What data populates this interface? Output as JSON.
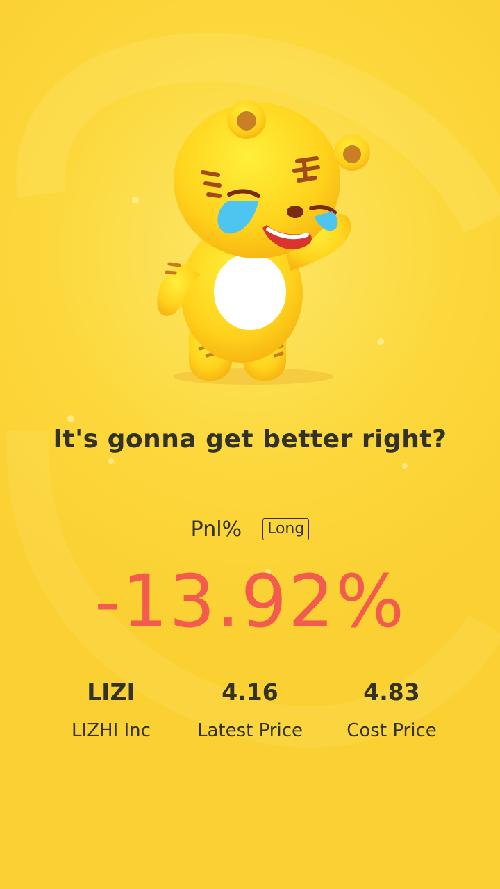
{
  "headline": "It's gonna get better right?",
  "pnl": {
    "label": "Pnl%",
    "position_badge": "Long",
    "value": "-13.92%",
    "value_color": "#f45b4f"
  },
  "stats": [
    {
      "value": "LIZI",
      "label": "LIZHI Inc"
    },
    {
      "value": "4.16",
      "label": "Latest Price"
    },
    {
      "value": "4.83",
      "label": "Cost Price"
    }
  ],
  "mascot_icon": "crying-tiger-mascot-icon",
  "colors": {
    "background": "#fcd83c",
    "text": "#333226",
    "loss": "#f45b4f"
  }
}
